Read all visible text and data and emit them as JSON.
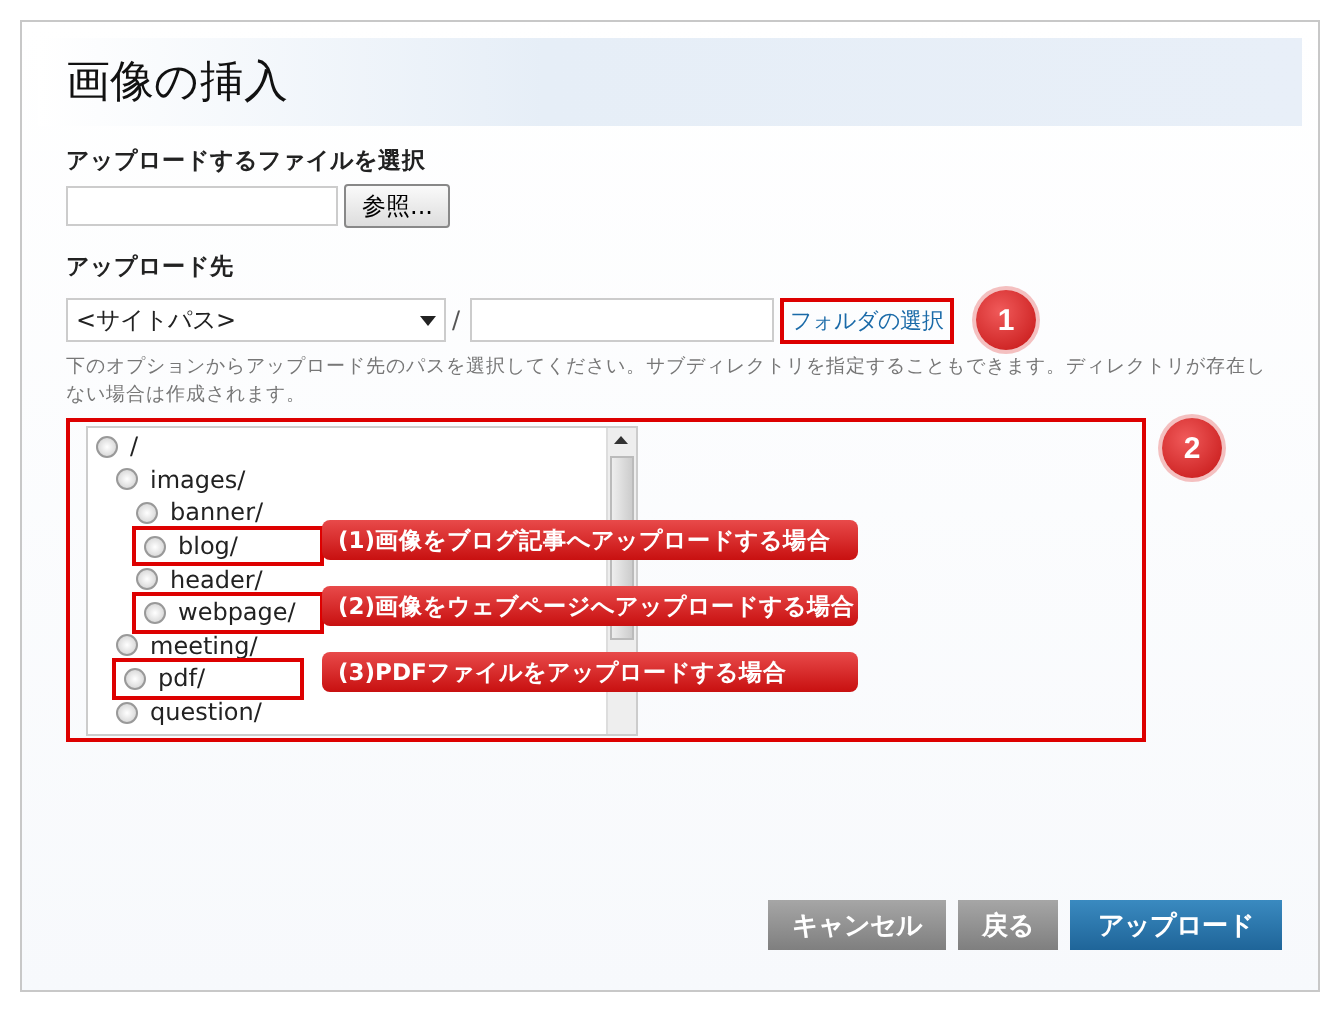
{
  "title": "画像の挿入",
  "file_section": {
    "label": "アップロードするファイルを選択",
    "browse_button": "参照..."
  },
  "destination": {
    "label": "アップロード先",
    "select_value": "<サイトパス>",
    "separator": "/",
    "folder_link": "フォルダの選択",
    "help": "下のオプションからアップロード先のパスを選択してください。サブディレクトリを指定することもできます。ディレクトリが存在しない場合は作成されます。"
  },
  "folder_tree": [
    {
      "label": "/",
      "selected": false,
      "highlighted": false,
      "children": [
        {
          "label": "images/",
          "selected": false,
          "highlighted": false,
          "children": [
            {
              "label": "banner/",
              "selected": false,
              "highlighted": false
            },
            {
              "label": "blog/",
              "selected": false,
              "highlighted": true
            },
            {
              "label": "header/",
              "selected": false,
              "highlighted": false
            },
            {
              "label": "webpage/",
              "selected": false,
              "highlighted": true
            }
          ]
        },
        {
          "label": "meeting/",
          "selected": false,
          "highlighted": false
        },
        {
          "label": "pdf/",
          "selected": false,
          "highlighted": true
        },
        {
          "label": "question/",
          "selected": false,
          "highlighted": false
        }
      ]
    }
  ],
  "callouts": [
    "(1)画像をブログ記事へアップロードする場合",
    "(2)画像をウェブページへアップロードする場合",
    "(3)PDFファイルをアップロードする場合"
  ],
  "badges": [
    "1",
    "2"
  ],
  "buttons": [
    {
      "label": "キャンセル",
      "kind": "secondary"
    },
    {
      "label": "戻る",
      "kind": "secondary"
    },
    {
      "label": "アップロード",
      "kind": "primary"
    }
  ]
}
